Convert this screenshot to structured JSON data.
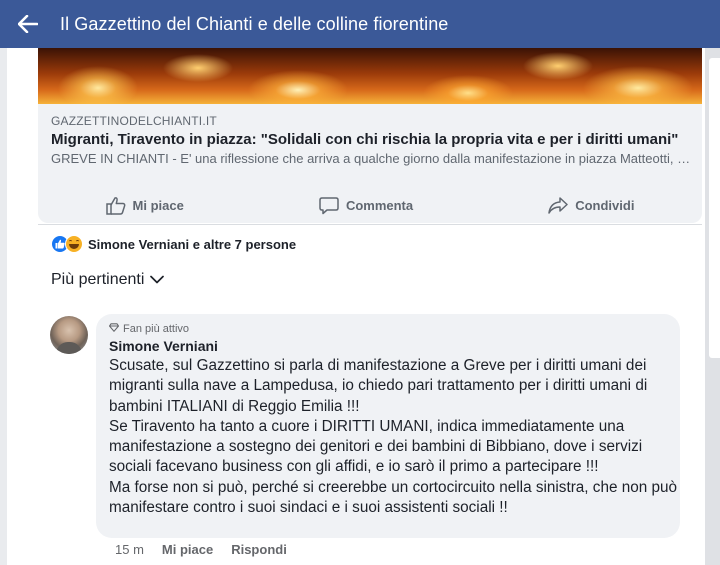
{
  "header": {
    "title": "Il Gazzettino del Chianti e delle colline fiorentine",
    "back_icon": "arrow-left-icon"
  },
  "link_card": {
    "source": "GAZZETTINODELCHIANTI.IT",
    "title": "Migranti, Tiravento in piazza: \"Solidali con chi rischia la propria vita e per i diritti umani\"",
    "description": "GREVE IN CHIANTI - E' una riflessione che arriva a qualche giorno dalla manifestazione in piazza Matteotti, che..."
  },
  "actions": {
    "like": "Mi piace",
    "comment": "Commenta",
    "share": "Condividi"
  },
  "reactions": {
    "summary": "Simone Verniani e altre 7 persone",
    "icons": [
      "like-icon",
      "laugh-icon"
    ]
  },
  "sort": {
    "label": "Più pertinenti"
  },
  "comment": {
    "badge": "Fan più attivo",
    "author": "Simone Verniani",
    "paragraphs": [
      "Scusate, sul Gazzettino si parla di manifestazione a Greve per i diritti umani dei migranti sulla nave a Lampedusa, io chiedo pari trattamento per i diritti umani di bambini ITALIANI di Reggio Emilia !!!",
      "Se Tiravento ha tanto a cuore i DIRITTI UMANI, indica immediatamente una manifestazione a sostegno dei genitori e dei bambini di Bibbiano, dove i servizi sociali facevano business con gli affidi, e io sarò il primo a partecipare !!!",
      "Ma forse non si può, perché si creerebbe un cortocircuito nella sinistra, che non può manifestare contro i suoi sindaci e i suoi assistenti sociali !!"
    ],
    "time": "15 m",
    "like": "Mi piace",
    "reply": "Rispondi"
  },
  "colors": {
    "header_bg": "#3b5998",
    "page_bg": "#e9ebee",
    "bubble_bg": "#f0f2f5",
    "like_blue": "#1877f2"
  }
}
